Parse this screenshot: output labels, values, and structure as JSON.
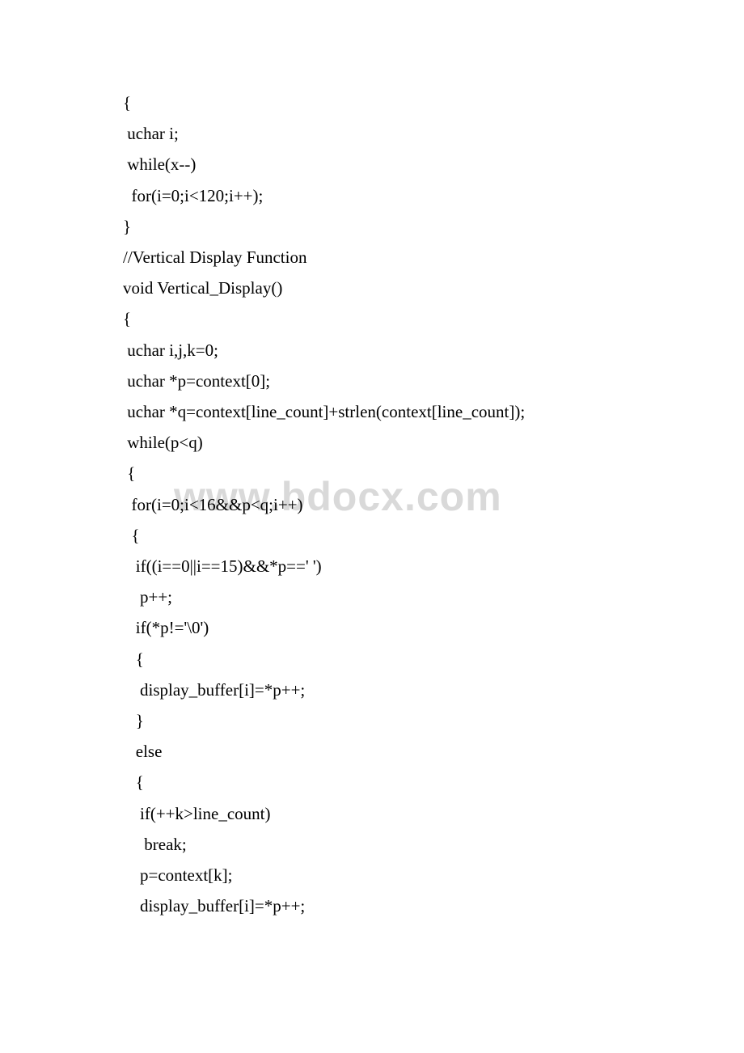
{
  "watermark": "www.bdocx.com",
  "code": {
    "lines": [
      "{",
      " uchar i;",
      " while(x--)",
      "  for(i=0;i<120;i++);",
      "}",
      "//Vertical Display Function",
      "void Vertical_Display()",
      "{",
      " uchar i,j,k=0;",
      " uchar *p=context[0];",
      " uchar *q=context[line_count]+strlen(context[line_count]);",
      " while(p<q)",
      " {",
      "  for(i=0;i<16&&p<q;i++)",
      "  {",
      "   if((i==0||i==15)&&*p==' ')",
      "    p++;",
      "   if(*p!='\\0')",
      "   {",
      "    display_buffer[i]=*p++;",
      "   }",
      "   else",
      "   {",
      "    if(++k>line_count)",
      "     break;",
      "    p=context[k];",
      "    display_buffer[i]=*p++;"
    ]
  }
}
